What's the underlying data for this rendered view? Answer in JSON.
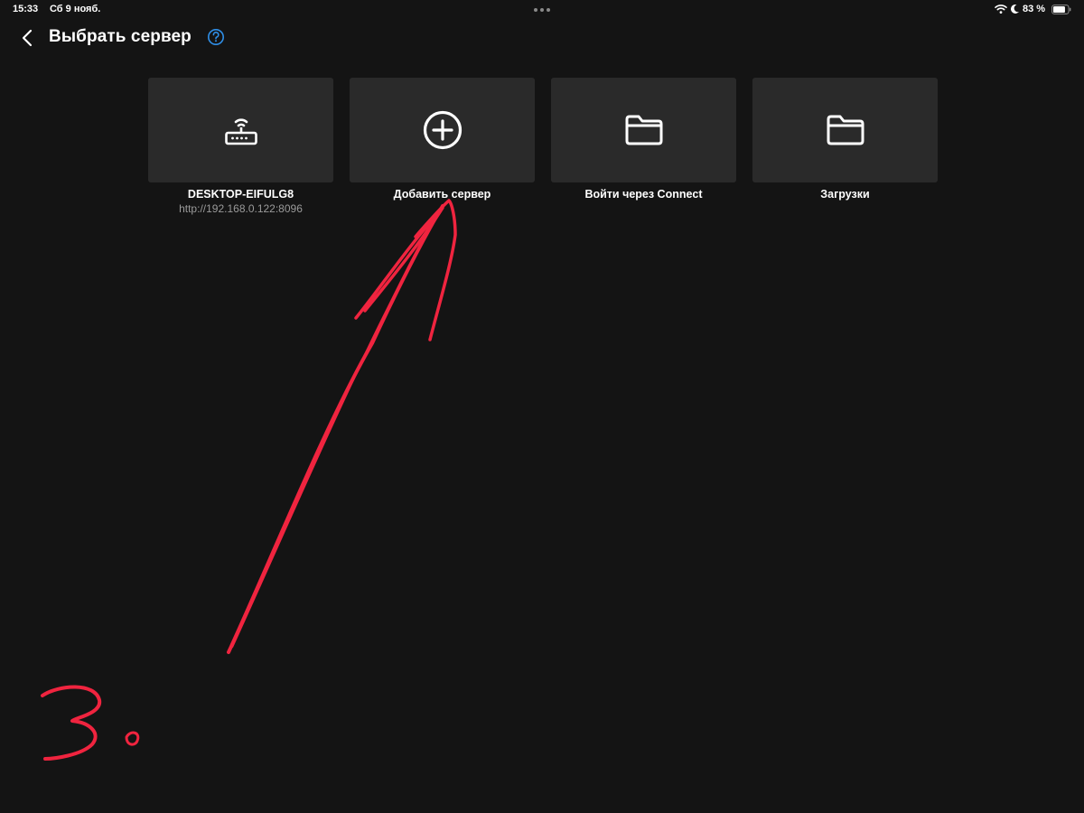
{
  "status_bar": {
    "time": "15:33",
    "date": "Сб 9 нояб.",
    "battery_percent": "83 %",
    "battery_level": 0.83,
    "icons": [
      "wifi-icon",
      "moon-icon",
      "battery-icon"
    ]
  },
  "header": {
    "title": "Выбрать сервер",
    "back_icon": "chevron-left-icon",
    "help_icon": "question-circle-icon"
  },
  "tiles": [
    {
      "title": "DESKTOP-EIFULG8",
      "subtitle": "http://192.168.0.122:8096",
      "icon": "router-icon"
    },
    {
      "title": "Добавить сервер",
      "subtitle": "",
      "icon": "plus-circle-icon"
    },
    {
      "title": "Войти через Connect",
      "subtitle": "",
      "icon": "folder-icon"
    },
    {
      "title": "Загрузки",
      "subtitle": "",
      "icon": "folder-icon"
    }
  ],
  "annotation": {
    "label": "3.",
    "color": "#f0243f"
  },
  "colors": {
    "background": "#141414",
    "tile": "#2a2a2a",
    "accent_help": "#2f8fe8",
    "subtitle": "#9a9a9a"
  }
}
